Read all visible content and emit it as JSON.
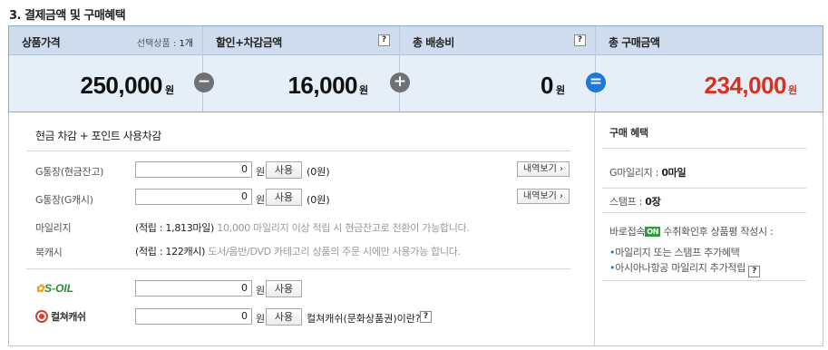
{
  "section_title": "3. 결제금액 및 구매혜택",
  "summary": {
    "product_price": {
      "label": "상품가격",
      "selected_label": "선택상품 :",
      "selected_count": "1개",
      "amount": "250,000",
      "unit": "원"
    },
    "discount": {
      "label": "할인+차감금액",
      "help": "?",
      "amount": "16,000",
      "unit": "원"
    },
    "shipping": {
      "label": "총 배송비",
      "help": "?",
      "amount": "0",
      "unit": "원"
    },
    "total": {
      "label": "총 구매금액",
      "amount": "234,000",
      "unit": "원"
    },
    "operators": {
      "minus": "−",
      "plus": "+",
      "equals": "="
    }
  },
  "deduction": {
    "title": "현금 차감 + 포인트 사용차감",
    "gbank_cash": {
      "label": "G통장(현금잔고)",
      "value": "0",
      "unit": "원",
      "use_button": "사용",
      "balance": "(0원)",
      "detail_button": "내역보기 ›"
    },
    "gbank_gcash": {
      "label": "G통장(G캐시)",
      "value": "0",
      "unit": "원",
      "use_button": "사용",
      "balance": "(0원)",
      "detail_button": "내역보기 ›"
    },
    "mileage": {
      "label": "마일리지",
      "accrued": "(적립 : 1,813마일)",
      "note": "10,000 마일리지 이상 적립 시 현금잔고로 전환이 가능합니다."
    },
    "bookcash": {
      "label": "북캐시",
      "accrued": "(적립 : 122캐시)",
      "note": "도서/음반/DVD 카테고리 상품의 주문 시에만 사용가능 합니다."
    },
    "soil": {
      "logo": "S-OIL",
      "value": "0",
      "unit": "원",
      "use_button": "사용"
    },
    "culture": {
      "logo": "컬쳐캐쉬",
      "value": "0",
      "unit": "원",
      "use_button": "사용",
      "help_text": "컬쳐캐쉬(문화상품권)이란?",
      "help": "?"
    }
  },
  "benefits": {
    "title": "구매 혜택",
    "g_mileage_label": "G마일리지 : ",
    "g_mileage_value": "0마일",
    "stamp_label": "스탬프 : ",
    "stamp_value": "0장",
    "review_prefix": "바로접속",
    "review_badge": "ON",
    "review_suffix": " 수취확인후 상품평 작성시 :",
    "bullet_1": "마일리지 또는 스탬프 추가혜택",
    "bullet_2": "아시아나항공 마일리지 추가적립",
    "bullet_2_help": "?"
  },
  "colors": {
    "total_amount": "#d8321e",
    "header_bg": "#cfdcee",
    "summary_bg": "#e6eef8",
    "equals_icon": "#1c79d6"
  }
}
